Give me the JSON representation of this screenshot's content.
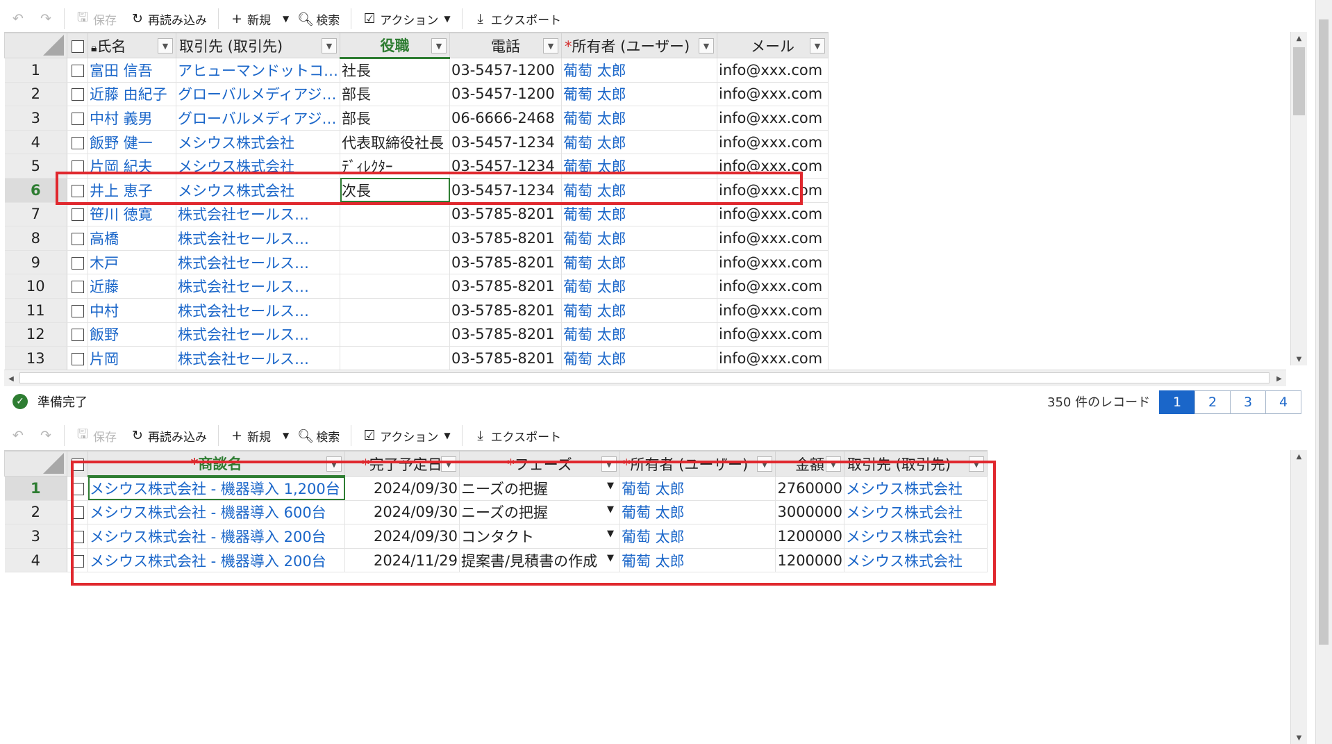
{
  "toolbar": {
    "save": "保存",
    "reload": "再読み込み",
    "new": "新規",
    "search": "検索",
    "action": "アクション",
    "export": "エクスポート"
  },
  "contacts": {
    "columns": [
      "氏名",
      "取引先 (取引先)",
      "役職",
      "電話",
      "所有者 (ユーザー)",
      "メール"
    ],
    "rows": [
      {
        "no": "1",
        "name": "富田 信吾",
        "account": "アヒューマンドットコ…",
        "title": "社長",
        "phone": "03-5457-1200",
        "owner": "葡萄 太郎",
        "email": "info@xxx.com"
      },
      {
        "no": "2",
        "name": "近藤 由紀子",
        "account": "グローバルメディアジ…",
        "title": "部長",
        "phone": "03-5457-1200",
        "owner": "葡萄 太郎",
        "email": "info@xxx.com"
      },
      {
        "no": "3",
        "name": "中村 義男",
        "account": "グローバルメディアジ…",
        "title": "部長",
        "phone": "06-6666-2468",
        "owner": "葡萄 太郎",
        "email": "info@xxx.com"
      },
      {
        "no": "4",
        "name": "飯野 健一",
        "account": "メシウス株式会社",
        "title": "代表取締役社長",
        "phone": "03-5457-1234",
        "owner": "葡萄 太郎",
        "email": "info@xxx.com"
      },
      {
        "no": "5",
        "name": "片岡 紀夫",
        "account": "メシウス株式会社",
        "title": "ﾃﾞｨﾚｸﾀｰ",
        "phone": "03-5457-1234",
        "owner": "葡萄 太郎",
        "email": "info@xxx.com"
      },
      {
        "no": "6",
        "name": "井上 恵子",
        "account": "メシウス株式会社",
        "title": "次長",
        "phone": "03-5457-1234",
        "owner": "葡萄 太郎",
        "email": "info@xxx.com"
      },
      {
        "no": "7",
        "name": "笹川 徳寛",
        "account": "株式会社セールス…",
        "title": "",
        "phone": "03-5785-8201",
        "owner": "葡萄 太郎",
        "email": "info@xxx.com"
      },
      {
        "no": "8",
        "name": "高橋",
        "account": "株式会社セールス…",
        "title": "",
        "phone": "03-5785-8201",
        "owner": "葡萄 太郎",
        "email": "info@xxx.com"
      },
      {
        "no": "9",
        "name": "木戸",
        "account": "株式会社セールス…",
        "title": "",
        "phone": "03-5785-8201",
        "owner": "葡萄 太郎",
        "email": "info@xxx.com"
      },
      {
        "no": "10",
        "name": "近藤",
        "account": "株式会社セールス…",
        "title": "",
        "phone": "03-5785-8201",
        "owner": "葡萄 太郎",
        "email": "info@xxx.com"
      },
      {
        "no": "11",
        "name": "中村",
        "account": "株式会社セールス…",
        "title": "",
        "phone": "03-5785-8201",
        "owner": "葡萄 太郎",
        "email": "info@xxx.com"
      },
      {
        "no": "12",
        "name": "飯野",
        "account": "株式会社セールス…",
        "title": "",
        "phone": "03-5785-8201",
        "owner": "葡萄 太郎",
        "email": "info@xxx.com"
      },
      {
        "no": "13",
        "name": "片岡",
        "account": "株式会社セールス…",
        "title": "",
        "phone": "03-5785-8201",
        "owner": "葡萄 太郎",
        "email": "info@xxx.com"
      }
    ]
  },
  "status": {
    "text": "準備完了",
    "records": "350 件のレコード",
    "pages": [
      "1",
      "2",
      "3",
      "4"
    ],
    "current_page": "1"
  },
  "opportunities": {
    "columns": [
      "商談名",
      "完了予定日",
      "フェーズ",
      "所有者 (ユーザー)",
      "金額",
      "取引先 (取引先)"
    ],
    "rows": [
      {
        "no": "1",
        "name": "メシウス株式会社 - 機器導入 1,200台",
        "date": "2024/09/30",
        "phase": "ニーズの把握",
        "owner": "葡萄 太郎",
        "amount": "2760000",
        "account": "メシウス株式会社"
      },
      {
        "no": "2",
        "name": "メシウス株式会社 - 機器導入 600台",
        "date": "2024/09/30",
        "phase": "ニーズの把握",
        "owner": "葡萄 太郎",
        "amount": "3000000",
        "account": "メシウス株式会社"
      },
      {
        "no": "3",
        "name": "メシウス株式会社 - 機器導入 200台",
        "date": "2024/09/30",
        "phase": "コンタクト",
        "owner": "葡萄 太郎",
        "amount": "1200000",
        "account": "メシウス株式会社"
      },
      {
        "no": "4",
        "name": "メシウス株式会社 - 機器導入 200台",
        "date": "2024/11/29",
        "phase": "提案書/見積書の作成",
        "owner": "葡萄 太郎",
        "amount": "1200000",
        "account": "メシウス株式会社"
      }
    ]
  },
  "colors": {
    "accent_green": "#2e7d32",
    "link_blue": "#1a66c9",
    "highlight_red": "#e0282e"
  }
}
